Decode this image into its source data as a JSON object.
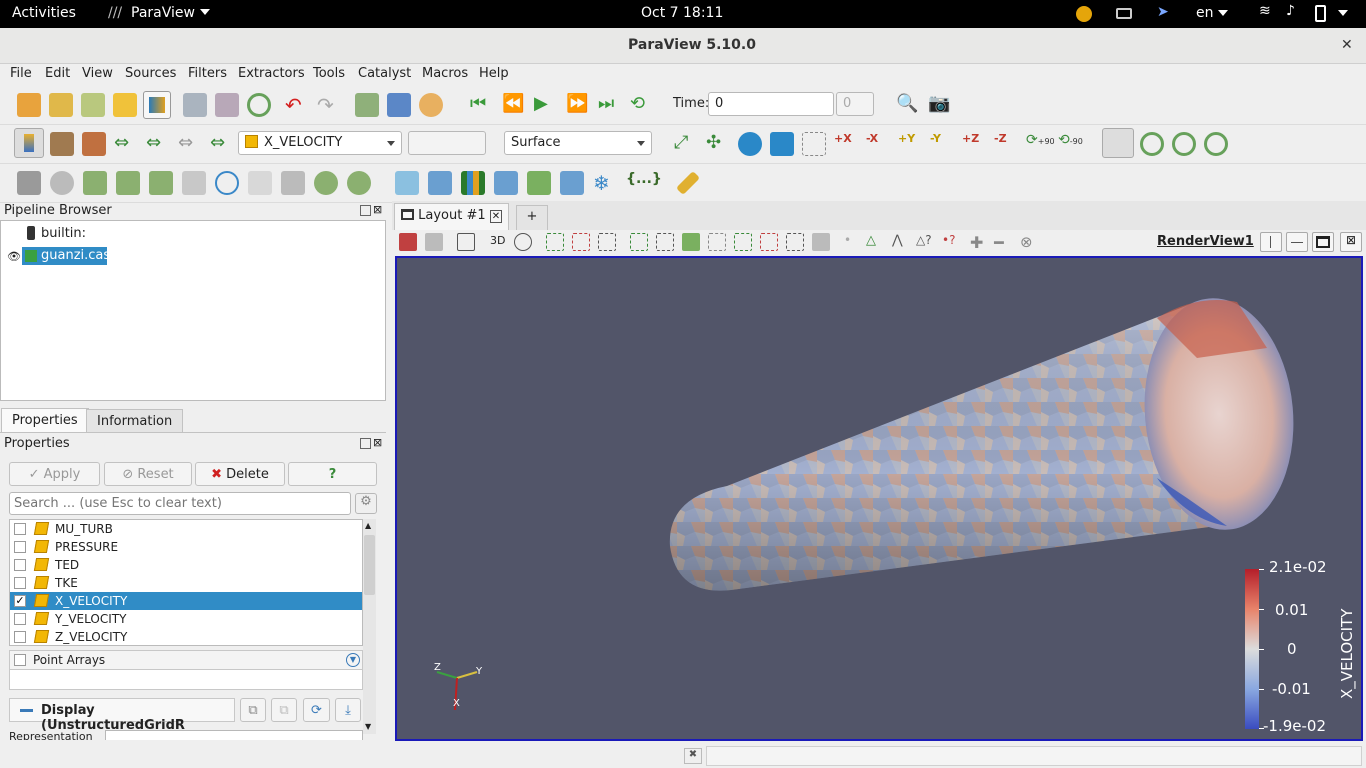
{
  "topbar": {
    "activities": "Activities",
    "app": "ParaView",
    "datetime": "Oct 7  18:11",
    "lang": "en"
  },
  "window": {
    "title": "ParaView 5.10.0",
    "close": "✕"
  },
  "menu": [
    "File",
    "Edit",
    "View",
    "Sources",
    "Filters",
    "Extractors",
    "Tools",
    "Catalyst",
    "Macros",
    "Help"
  ],
  "toolbar1": {
    "time_label": "Time:",
    "time_value": "0",
    "time_index": "0"
  },
  "toolbar2": {
    "color_array": "X_VELOCITY",
    "component": "",
    "representation": "Surface",
    "rot_plus": "+90",
    "rot_minus": "-90"
  },
  "pipeline": {
    "title": "Pipeline Browser",
    "root": "builtin:",
    "source": "guanzi.cas"
  },
  "tabs": {
    "properties": "Properties",
    "information": "Information"
  },
  "properties": {
    "title": "Properties",
    "apply": "Apply",
    "reset": "Reset",
    "delete": "Delete",
    "help": "?",
    "search_placeholder": "Search ... (use Esc to clear text)",
    "arrays": [
      {
        "name": "MU_TURB",
        "checked": false
      },
      {
        "name": "PRESSURE",
        "checked": false
      },
      {
        "name": "TED",
        "checked": false
      },
      {
        "name": "TKE",
        "checked": false
      },
      {
        "name": "X_VELOCITY",
        "checked": true
      },
      {
        "name": "Y_VELOCITY",
        "checked": false
      },
      {
        "name": "Z_VELOCITY",
        "checked": false
      }
    ],
    "point_arrays": "Point Arrays",
    "display_section": "Display (UnstructuredGridR",
    "representation_label": "Representation"
  },
  "layout": {
    "tab": "Layout #1",
    "add": "+",
    "view_name": "RenderView1",
    "mode_3d": "3D"
  },
  "colorbar": {
    "title": "X_VELOCITY",
    "ticks": [
      "2.1e-02",
      "0.01",
      "0",
      "-0.01",
      "-1.9e-02"
    ]
  },
  "axes": {
    "x": "X",
    "y": "Y",
    "z": "Z"
  },
  "colors": {
    "accent": "#3584e4",
    "view_bg": "#525569",
    "selection": "#308cc6"
  }
}
